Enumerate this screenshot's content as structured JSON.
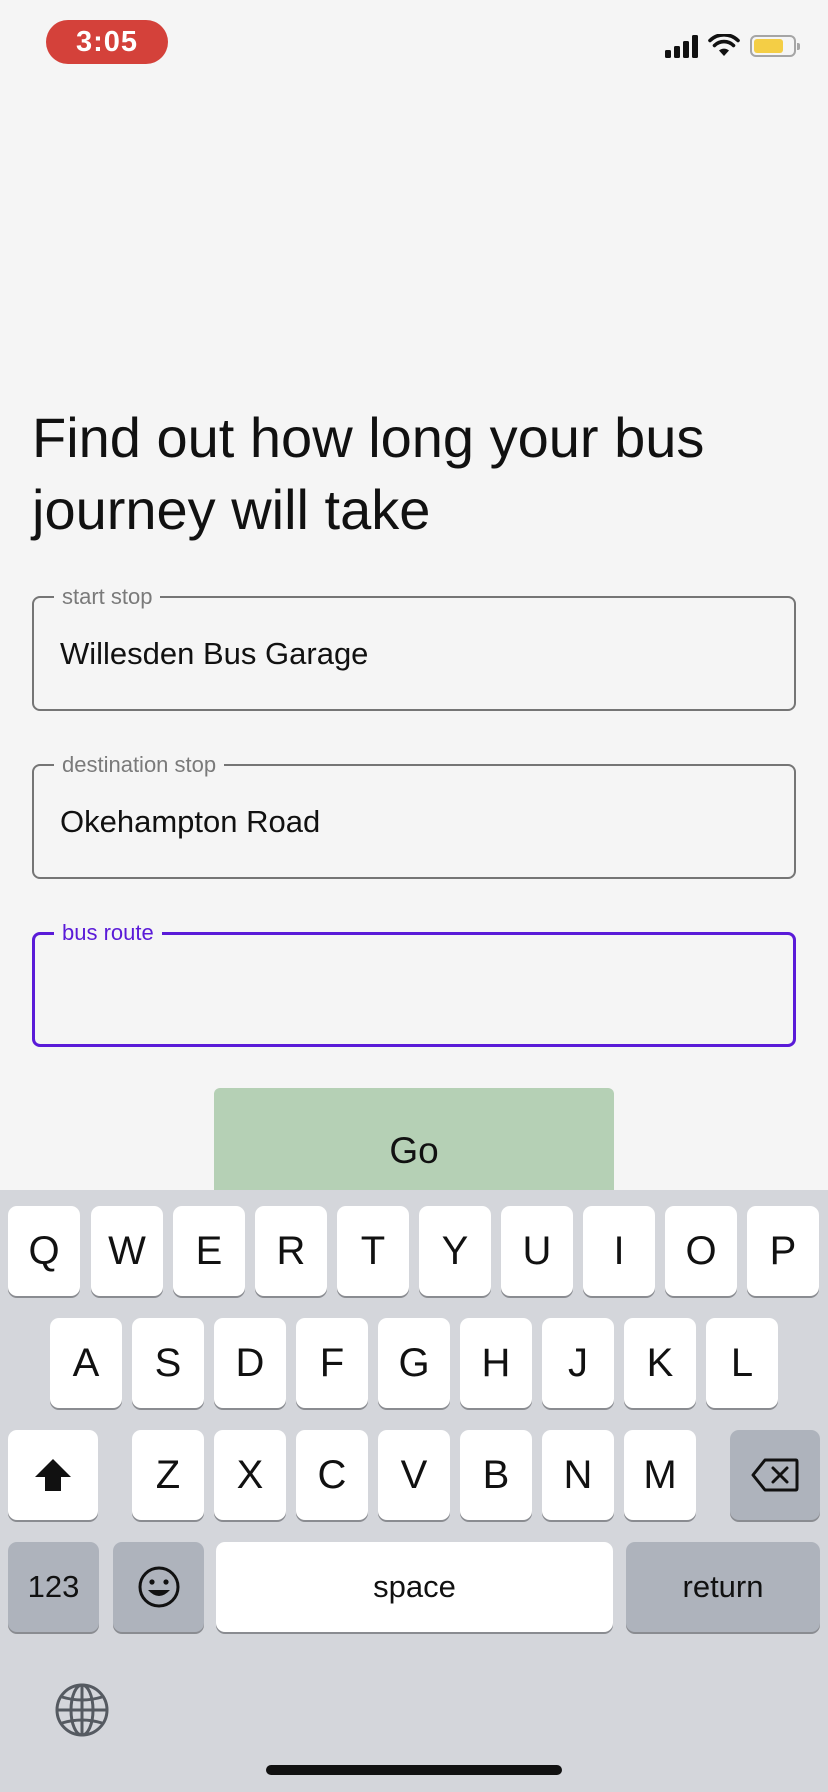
{
  "status_bar": {
    "time": "3:05",
    "battery_level": 0.75,
    "colors": {
      "time_pill": "#d4413a",
      "battery": "#f4ce45"
    }
  },
  "page": {
    "heading": "Find out how long your bus journey will take"
  },
  "form": {
    "start_stop": {
      "label": "start stop",
      "value": "Willesden Bus Garage"
    },
    "destination_stop": {
      "label": "destination stop",
      "value": "Okehampton Road"
    },
    "bus_route": {
      "label": "bus route",
      "value": "",
      "focused": true
    },
    "go_label": "Go",
    "accent_color": "#5a1ad8",
    "go_button_color": "#b5d0b5"
  },
  "keyboard": {
    "row1": [
      "Q",
      "W",
      "E",
      "R",
      "T",
      "Y",
      "U",
      "I",
      "O",
      "P"
    ],
    "row2": [
      "A",
      "S",
      "D",
      "F",
      "G",
      "H",
      "J",
      "K",
      "L"
    ],
    "row3": [
      "Z",
      "X",
      "C",
      "V",
      "B",
      "N",
      "M"
    ],
    "numbers_label": "123",
    "space_label": "space",
    "return_label": "return",
    "icons": [
      "shift-icon",
      "backspace-icon",
      "emoji-icon",
      "globe-icon"
    ]
  }
}
